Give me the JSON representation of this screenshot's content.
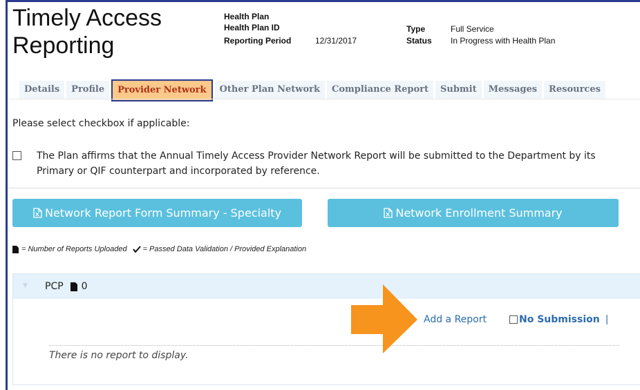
{
  "header": {
    "title": "Timely Access Reporting",
    "labels": {
      "health_plan": "Health Plan",
      "health_plan_id": "Health Plan ID",
      "reporting_period": "Reporting Period",
      "type": "Type",
      "status": "Status"
    },
    "values": {
      "reporting_period": "12/31/2017",
      "type": "Full Service",
      "status": "In Progress with Health Plan"
    }
  },
  "tabs": [
    {
      "label": "Details"
    },
    {
      "label": "Profile"
    },
    {
      "label": "Provider Network",
      "active": true
    },
    {
      "label": "Other Plan Network"
    },
    {
      "label": "Compliance Report"
    },
    {
      "label": "Submit"
    },
    {
      "label": "Messages"
    },
    {
      "label": "Resources"
    }
  ],
  "form": {
    "prompt": "Please select checkbox if applicable:",
    "affirm_text": "The Plan affirms that the Annual Timely Access Provider Network Report will be submitted to the Department by its Primary or QIF counterpart and incorporated by reference.",
    "affirm_checked": false
  },
  "buttons": {
    "specialty": "Network Report Form Summary - Specialty",
    "enrollment": "Network Enrollment Summary"
  },
  "legend": {
    "uploaded": "= Number of Reports Uploaded",
    "validated": "= Passed Data Validation / Provided Explanation"
  },
  "panel": {
    "name": "PCP",
    "count": "0",
    "add_report": "Add a Report",
    "no_submission": "No Submission",
    "separator": "|",
    "empty_message": "There is no report to display."
  },
  "colors": {
    "accent": "#5bc0de",
    "active_tab": "#fbc98a",
    "frame": "#2a3b8f",
    "arrow": "#f7941d",
    "link": "#2b6cb0"
  },
  "icons": {
    "button_icon": "excel-file-icon",
    "uploaded": "file-icon",
    "validated": "checkmark-icon",
    "annotation": "orange-arrow-icon"
  }
}
